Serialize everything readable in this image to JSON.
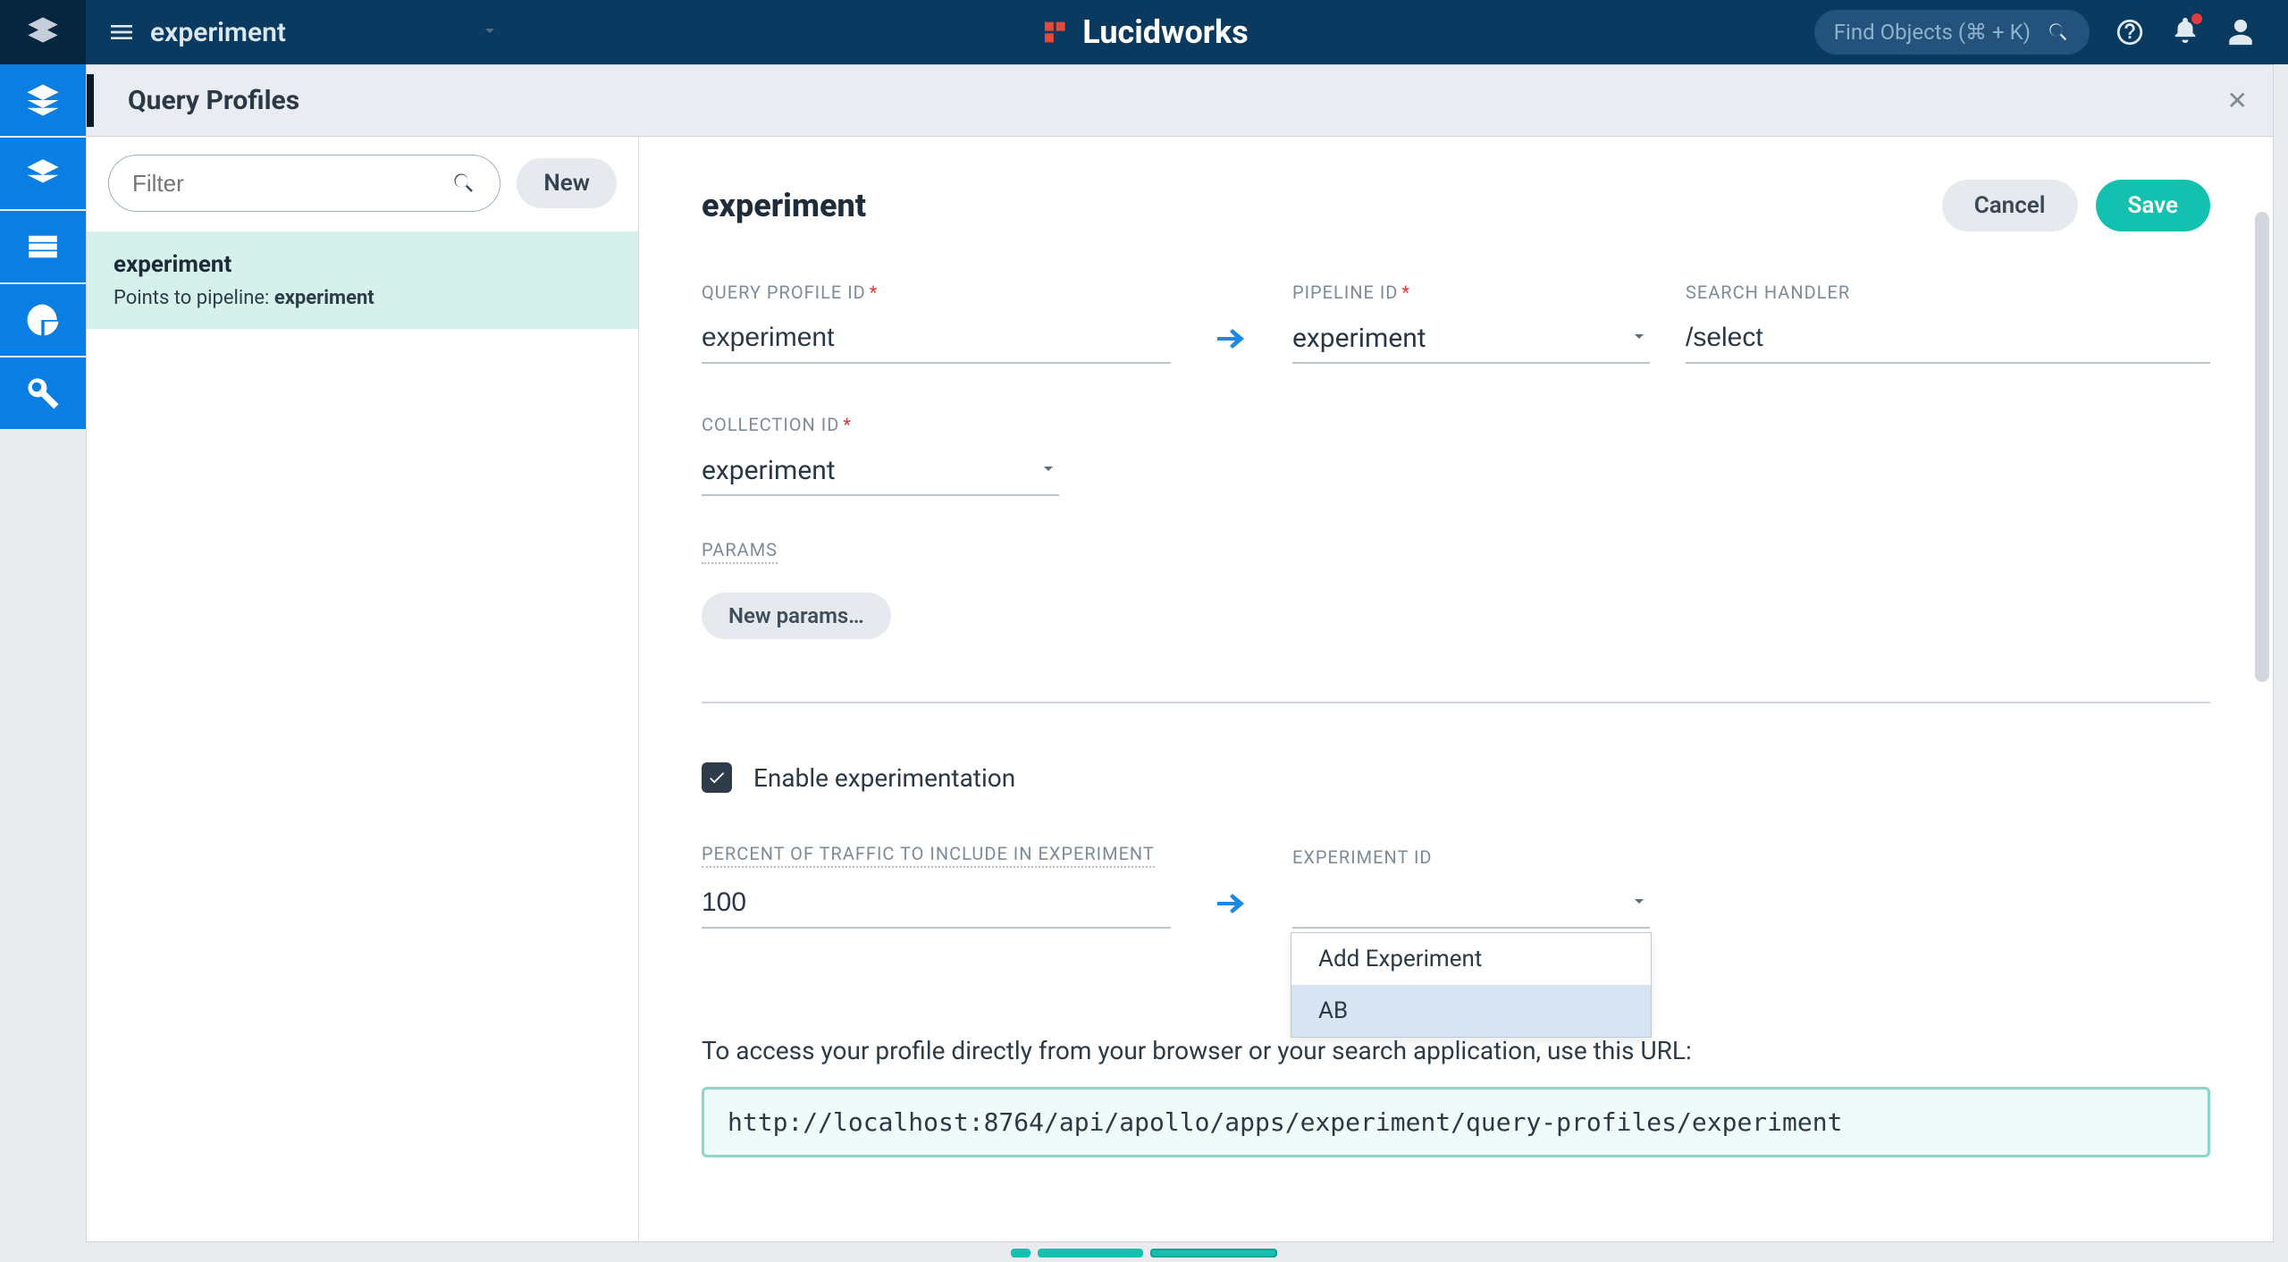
{
  "header": {
    "workspace_label": "experiment",
    "brand": "Lucidworks",
    "search_placeholder": "Find Objects (⌘ + K)"
  },
  "panel": {
    "title": "Query Profiles"
  },
  "sidebar": {
    "filter_placeholder": "Filter",
    "new_label": "New",
    "items": [
      {
        "name": "experiment",
        "meta_prefix": "Points to pipeline: ",
        "meta_value": "experiment"
      }
    ]
  },
  "main": {
    "heading": "experiment",
    "cancel": "Cancel",
    "save": "Save",
    "fields": {
      "query_profile_id": {
        "label": "QUERY PROFILE ID",
        "value": "experiment",
        "required": true
      },
      "pipeline_id": {
        "label": "PIPELINE ID",
        "value": "experiment",
        "required": true
      },
      "search_handler": {
        "label": "SEARCH HANDLER",
        "value": "/select",
        "required": false
      },
      "collection_id": {
        "label": "COLLECTION ID",
        "value": "experiment",
        "required": true
      },
      "params": {
        "label": "PARAMS",
        "button": "New params…"
      },
      "enable_experimentation": {
        "label": "Enable experimentation",
        "checked": true
      },
      "traffic_pct": {
        "label": "PERCENT OF TRAFFIC TO INCLUDE IN EXPERIMENT",
        "value": "100"
      },
      "experiment_id": {
        "label": "EXPERIMENT ID",
        "value": "",
        "options": [
          "Add Experiment",
          "AB"
        ]
      }
    },
    "hint": "To access your profile directly from your browser or your search application, use this URL:",
    "url": "http://localhost:8764/api/apollo/apps/experiment/query-profiles/experiment"
  }
}
